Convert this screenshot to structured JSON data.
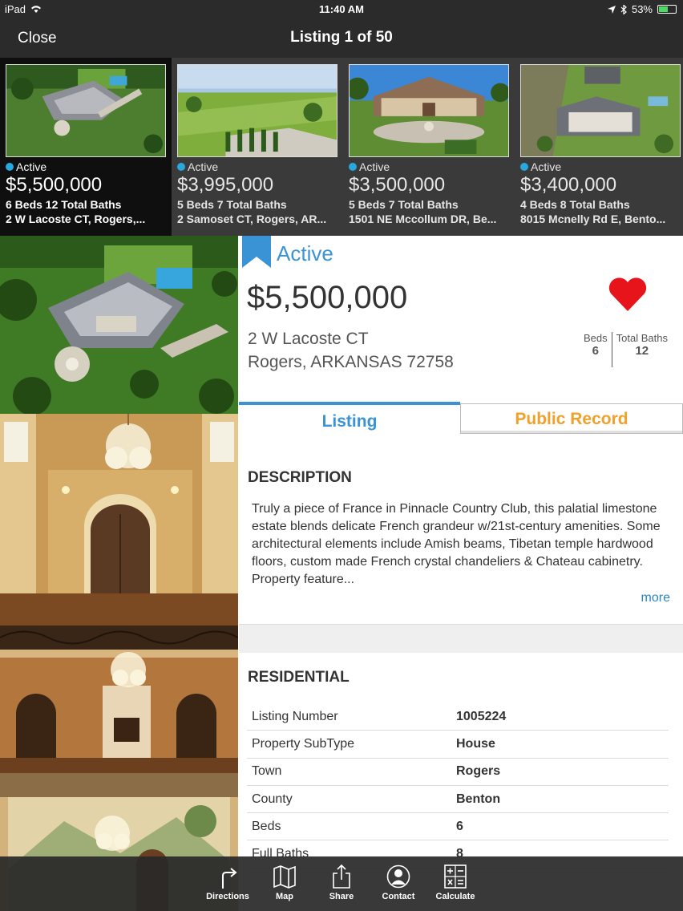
{
  "status_bar": {
    "device": "iPad",
    "time": "11:40 AM",
    "battery": "53%"
  },
  "nav": {
    "close_label": "Close",
    "title": "Listing 1 of 50"
  },
  "carousel": [
    {
      "status": "Active",
      "price": "$5,500,000",
      "beds_baths": "6 Beds 12 Total Baths",
      "address": "2 W Lacoste CT, Rogers,...",
      "selected": true
    },
    {
      "status": "Active",
      "price": "$3,995,000",
      "beds_baths": "5 Beds 7 Total Baths",
      "address": "2 Samoset CT, Rogers, AR...",
      "selected": false
    },
    {
      "status": "Active",
      "price": "$3,500,000",
      "beds_baths": "5 Beds 7 Total Baths",
      "address": "1501 NE Mccollum DR, Be...",
      "selected": false
    },
    {
      "status": "Active",
      "price": "$3,400,000",
      "beds_baths": "4 Beds 8 Total Baths",
      "address": "8015 Mcnelly Rd E, Bento...",
      "selected": false
    }
  ],
  "listing": {
    "status": "Active",
    "price": "$5,500,000",
    "address_line1": "2 W Lacoste CT",
    "address_line2": "Rogers, ARKANSAS 72758",
    "beds_label": "Beds",
    "beds_value": "6",
    "baths_label": "Total Baths",
    "baths_value": "12",
    "favorite": true
  },
  "tabs": {
    "listing": "Listing",
    "public_record": "Public Record",
    "active": "Listing"
  },
  "description": {
    "heading": "DESCRIPTION",
    "text": "Truly a piece of France in Pinnacle Country Club, this palatial limestone estate blends delicate French grandeur w/21st-century amenities. Some architectural elements include Amish beams, Tibetan temple hardwood floors, custom made French crystal chandeliers & Chateau cabinetry. Property feature...",
    "more_label": "more"
  },
  "residential": {
    "heading": "RESIDENTIAL",
    "rows": [
      {
        "key": "Listing Number",
        "value": "1005224"
      },
      {
        "key": "Property SubType",
        "value": "House"
      },
      {
        "key": "Town",
        "value": "Rogers"
      },
      {
        "key": "County",
        "value": "Benton"
      },
      {
        "key": "Beds",
        "value": "6"
      },
      {
        "key": "Full Baths",
        "value": "8"
      }
    ]
  },
  "toolbar": {
    "directions": "Directions",
    "map": "Map",
    "share": "Share",
    "contact": "Contact",
    "calculate": "Calculate"
  },
  "colors": {
    "accent_blue": "#3a93d4",
    "public_record_orange": "#f0a12a",
    "heart_red": "#e8141b",
    "status_dot": "#29a8e0"
  }
}
